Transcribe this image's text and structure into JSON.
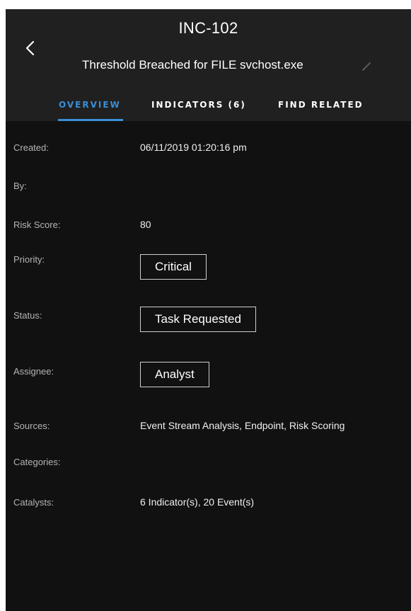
{
  "header": {
    "incident_id": "INC-102",
    "title": "Threshold Breached for FILE svchost.exe",
    "back_icon": "chevron-left-icon",
    "edit_icon": "pencil-icon"
  },
  "tabs": [
    {
      "label": "OVERVIEW",
      "active": true
    },
    {
      "label": "INDICATORS (6)",
      "active": false
    },
    {
      "label": "FIND RELATED",
      "active": false
    }
  ],
  "overview": {
    "created": {
      "label": "Created:",
      "value": "06/11/2019 01:20:16 pm"
    },
    "by": {
      "label": "By:",
      "value": ""
    },
    "risk_score": {
      "label": "Risk Score:",
      "value": "80"
    },
    "priority": {
      "label": "Priority:",
      "value": "Critical"
    },
    "status": {
      "label": "Status:",
      "value": "Task Requested"
    },
    "assignee": {
      "label": "Assignee:",
      "value": "Analyst"
    },
    "sources": {
      "label": "Sources:",
      "value": "Event Stream Analysis,  Endpoint,  Risk Scoring"
    },
    "categories": {
      "label": "Categories:",
      "value": ""
    },
    "catalysts": {
      "label": "Catalysts:",
      "value": "6 Indicator(s), 20 Event(s)"
    }
  },
  "colors": {
    "background": "#111111",
    "header": "#202020",
    "accent": "#3a8fd6",
    "label": "#b4b4b4",
    "text": "#f0f0f0"
  }
}
